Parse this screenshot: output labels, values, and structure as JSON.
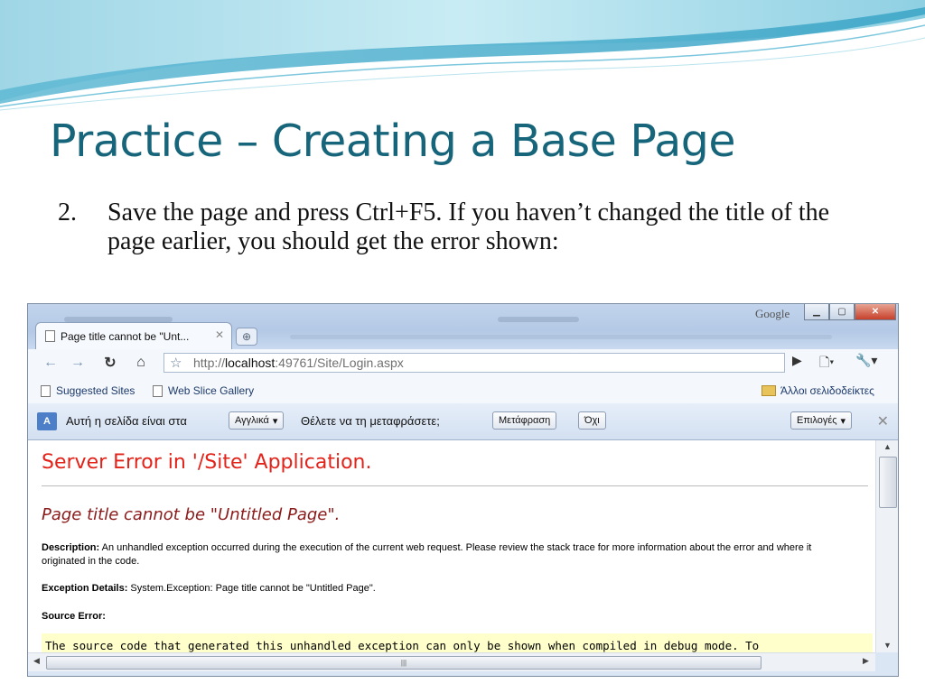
{
  "slide": {
    "title": "Practice – Creating a Base Page",
    "bullet_number": "2.",
    "bullet_text": "Save the page and press Ctrl+F5. If you haven’t changed the title of the page earlier, you should get the error shown:"
  },
  "browser": {
    "google_label": "Google",
    "tab_title": "Page title cannot be \"Unt...",
    "url_prefix": "http://",
    "url_host": "localhost",
    "url_rest": ":49761/Site/Login.aspx",
    "bookmarks": [
      "Suggested Sites",
      "Web Slice Gallery"
    ],
    "other_bookmarks": "Άλλοι σελιδοδείκτες",
    "translate_bar": {
      "prompt": "Αυτή η σελίδα είναι στα",
      "language": "Αγγλικά",
      "question": "Θέλετε να τη μεταφράσετε;",
      "translate_button": "Μετάφραση",
      "no_button": "Όχι",
      "options_button": "Επιλογές"
    },
    "icons": {
      "back": "back-arrow-icon",
      "forward": "forward-arrow-icon",
      "reload": "reload-icon",
      "home": "home-icon",
      "star": "star-icon",
      "page": "page-menu-icon",
      "wrench": "wrench-icon"
    }
  },
  "error_page": {
    "heading": "Server Error in '/Site' Application.",
    "subheading": "Page title cannot be \"Untitled Page\".",
    "description_label": "Description:",
    "description_text": "An unhandled exception occurred during the execution of the current web request. Please review the stack trace for more information about the error and where it originated in the code.",
    "exception_label": "Exception Details:",
    "exception_text": "System.Exception: Page title cannot be \"Untitled Page\".",
    "source_error_label": "Source Error:",
    "source_code_text": "The source code that generated this unhandled exception can only be shown when compiled in debug mode. To"
  }
}
